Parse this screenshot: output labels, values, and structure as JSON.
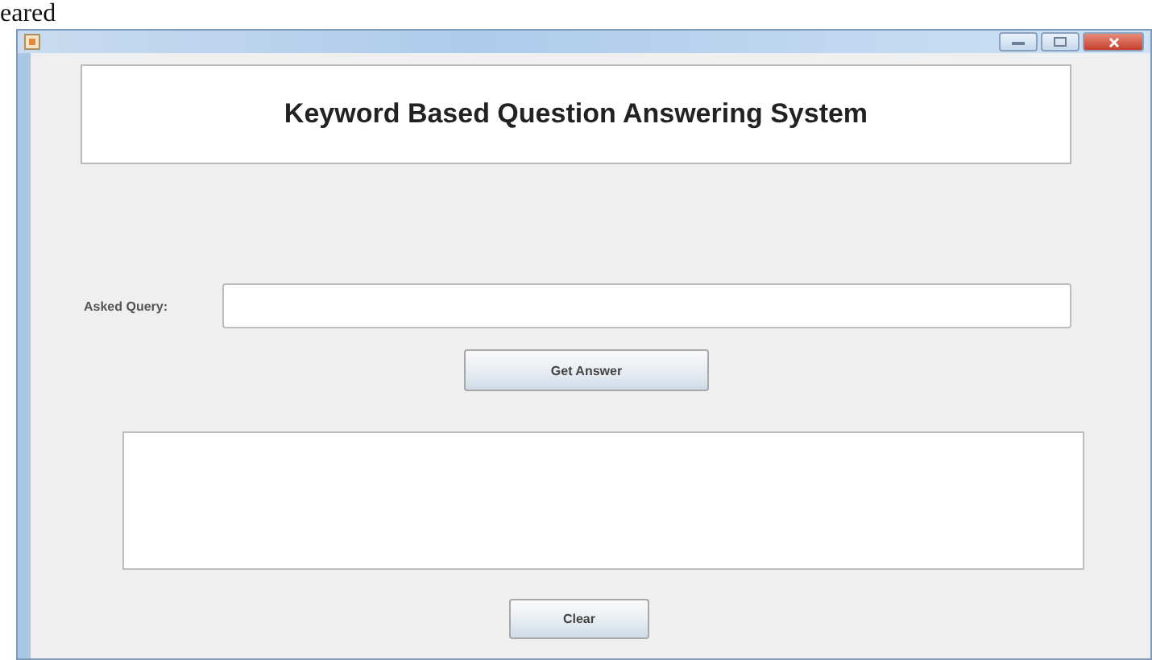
{
  "document_text": "eared",
  "header": {
    "title": "Keyword Based Question Answering System"
  },
  "query": {
    "label": "Asked Query:"
  },
  "buttons": [
    {
      "label": "Get Answer"
    },
    {
      "label": "Clear"
    }
  ]
}
